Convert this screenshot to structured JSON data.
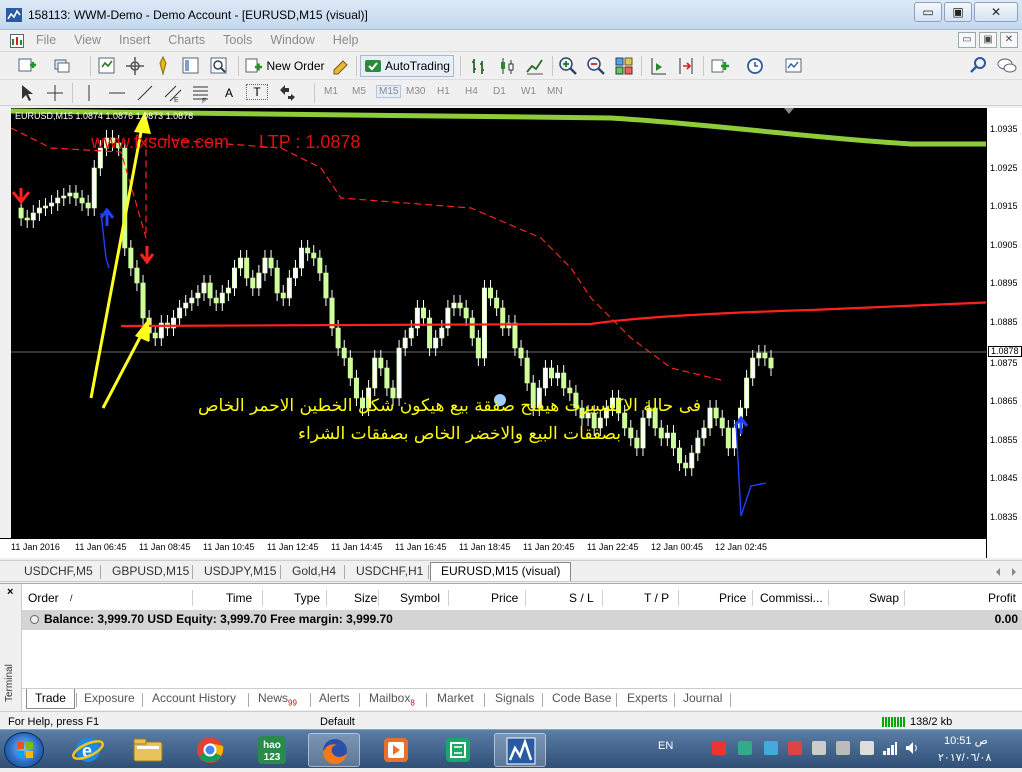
{
  "window": {
    "title": "158113: WWM-Demo - Demo Account - [EURUSD,M15 (visual)]",
    "min": "▭",
    "max": "▣",
    "close": "✕"
  },
  "menu": {
    "items": [
      "File",
      "View",
      "Insert",
      "Charts",
      "Tools",
      "Window",
      "Help"
    ],
    "mdi_min": "▭",
    "mdi_max": "▣",
    "mdi_close": "✕"
  },
  "toolbar": {
    "new_order": "New Order",
    "autotrading": "AutoTrading",
    "timeframes": [
      "M1",
      "M5",
      "M15",
      "M30",
      "H1",
      "H4",
      "D1",
      "W1",
      "MN"
    ],
    "active_timeframe": "M15",
    "text_tool": "A",
    "label_tool": "T"
  },
  "chart": {
    "info": "EURUSD,M15  1.0874 1.0876 1.0873 1.0878",
    "watermark": "www.fxsolve.com      LTP : 1.0878",
    "arabic_line1": "فى حالة الاكسبيرت هيفتح صفقة بيع هيكون شكل الخطين الاحمر الخاص",
    "arabic_line2": "بصفقات البيع والاخضر الخاص بصفقات الشراء",
    "price_labels": [
      "1.0935",
      "1.0925",
      "1.0915",
      "1.0905",
      "1.0895",
      "1.0885",
      "1.0875",
      "1.0865",
      "1.0855",
      "1.0845",
      "1.0835"
    ],
    "current_price": "1.0878",
    "time_labels": [
      "11 Jan 2016",
      "11 Jan 06:45",
      "11 Jan 08:45",
      "11 Jan 10:45",
      "11 Jan 12:45",
      "11 Jan 14:45",
      "11 Jan 16:45",
      "11 Jan 18:45",
      "11 Jan 20:45",
      "11 Jan 22:45",
      "12 Jan 00:45",
      "12 Jan 02:45"
    ]
  },
  "chart_tabs": [
    "USDCHF,M5",
    "GBPUSD,M15",
    "USDJPY,M15",
    "Gold,H4",
    "USDCHF,H1",
    "EURUSD,M15 (visual)"
  ],
  "terminal": {
    "side_label": "Terminal",
    "close": "×",
    "columns": [
      "Order",
      "/",
      "Time",
      "Type",
      "Size",
      "Symbol",
      "Price",
      "S / L",
      "T / P",
      "Price",
      "Commissi...",
      "Swap",
      "Profit"
    ],
    "balance_text": "Balance: 3,999.70 USD  Equity: 3,999.70  Free margin: 3,999.70",
    "profit": "0.00",
    "tabs": [
      {
        "label": "Trade",
        "badge": ""
      },
      {
        "label": "Exposure",
        "badge": ""
      },
      {
        "label": "Account History",
        "badge": ""
      },
      {
        "label": "News",
        "badge": "99"
      },
      {
        "label": "Alerts",
        "badge": ""
      },
      {
        "label": "Mailbox",
        "badge": "8"
      },
      {
        "label": "Market",
        "badge": ""
      },
      {
        "label": "Signals",
        "badge": ""
      },
      {
        "label": "Code Base",
        "badge": ""
      },
      {
        "label": "Experts",
        "badge": ""
      },
      {
        "label": "Journal",
        "badge": ""
      }
    ]
  },
  "status": {
    "help": "For Help, press F1",
    "profile": "Default",
    "traffic": "138/2 kb"
  },
  "taskbar": {
    "lang": "EN",
    "time": "10:51 ص",
    "date": "٢٠١٧/٠٦/٠٨",
    "hao_line1": "hao",
    "hao_line2": "123"
  }
}
